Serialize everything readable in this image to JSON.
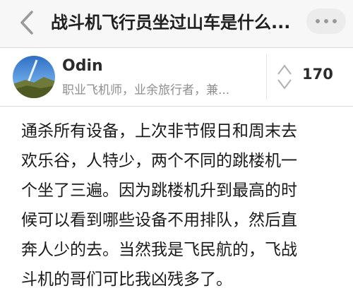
{
  "navbar": {
    "back_icon": "chevron-left-icon",
    "title": "战斗机飞行员坐过山车是什么...",
    "more_icon": "ellipsis-icon"
  },
  "author": {
    "name": "Odin",
    "bio": "职业飞机师，业余旅行者，兼...",
    "avatar_icon": "avatar-landscape"
  },
  "vote": {
    "icon": "up-down-arrows-icon",
    "count": "170"
  },
  "answer": {
    "lines": [
      "通杀所有设备，上次非节假日和周末去",
      "欢乐谷，人特少，两个不同的跳楼机一",
      "个坐了三遍。因为跳楼机升到最高的时",
      "候可以看到哪些设备不用排队，然后直",
      "奔人少的去。当然我是飞民航的，飞战",
      "斗机的哥们可比我凶残多了。"
    ]
  },
  "colors": {
    "navbar_bg": "#f7f7f7",
    "secondary_text": "#8e8e8e",
    "icon_gray": "#9a9a9a"
  }
}
